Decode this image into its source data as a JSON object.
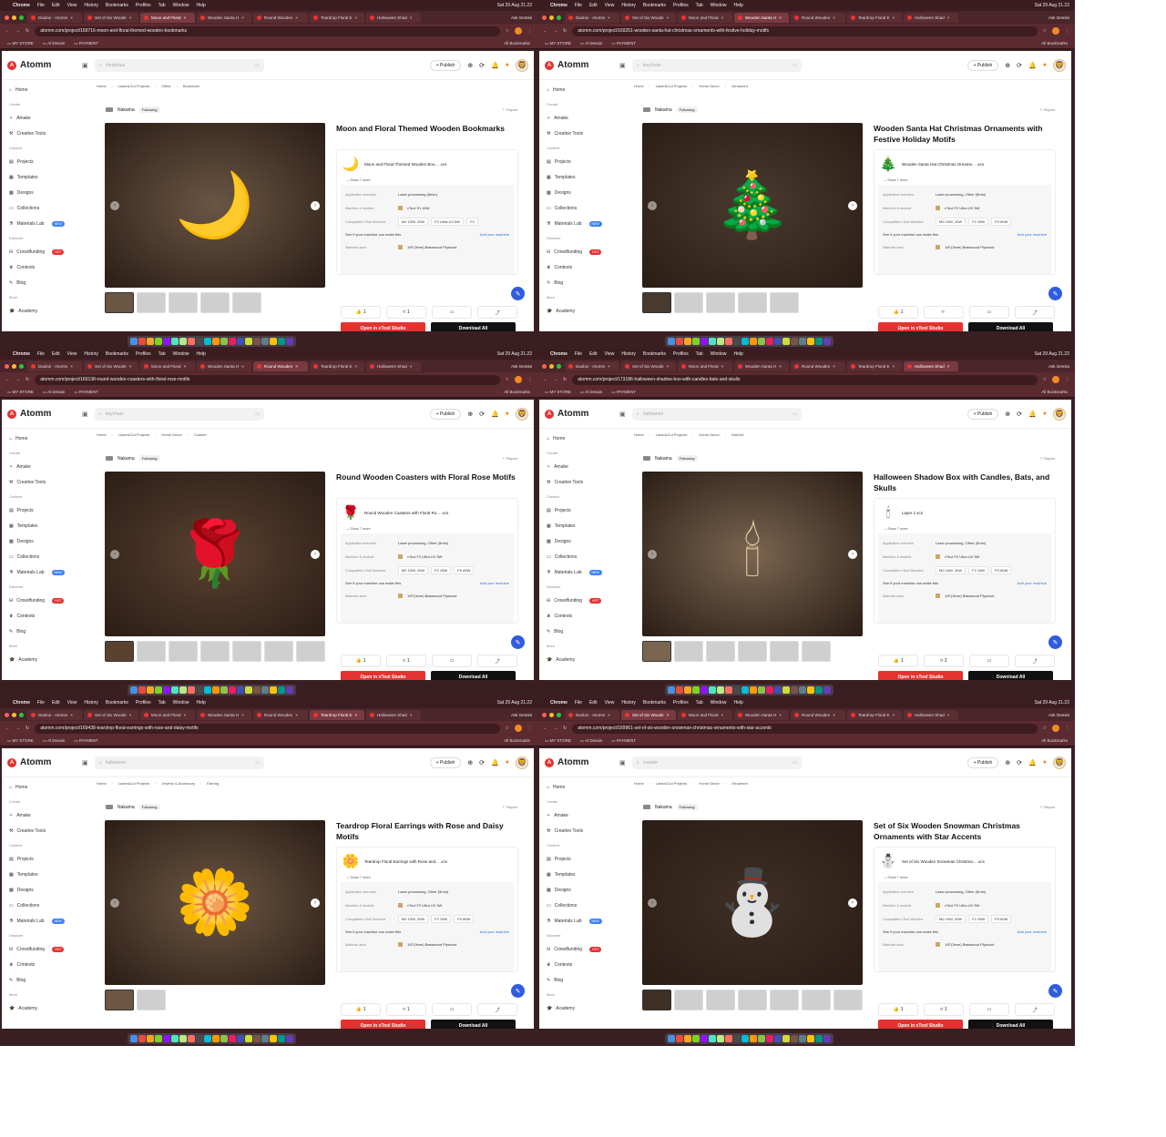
{
  "menubar": {
    "app": "Chrome",
    "items": [
      "File",
      "Edit",
      "View",
      "History",
      "Bookmarks",
      "Profiles",
      "Tab",
      "Window",
      "Help"
    ],
    "datetime": "Sat 29 Aug 21.22"
  },
  "tabs": [
    "Daoboi - Atomm",
    "Set of Six Woode",
    "Moon and Floral",
    "Wooden Santa H",
    "Round Wooden",
    "Teardrop Floral E",
    "Halloween Shad"
  ],
  "ask_label": "Ask Gemini",
  "bookmarks": [
    "MY STORE",
    "Al Desain",
    "PAYMENT"
  ],
  "all_bookmarks": "All Bookmarks",
  "site": {
    "logo": "Atomm",
    "publish": "+ Publish",
    "sidebar": {
      "home": "Home",
      "create_h": "Create",
      "amake": "Amake",
      "creative_tools": "Creative Tools",
      "content_h": "Content",
      "projects": "Projects",
      "templates": "Templates",
      "designs": "Designs",
      "collections": "Collections",
      "materials_lab": "Materials Lab",
      "new_badge": "NEW",
      "discover_h": "Discover",
      "crowdfunding": "Crowdfunding",
      "hot_badge": "HOT",
      "contests": "Contests",
      "blog": "Blog",
      "more_h": "More",
      "academy": "Academy"
    },
    "author": "Nakama",
    "following": "Following",
    "report": "Report",
    "show_more": "Show 7 more",
    "spec_labels": {
      "scenario": "Application scenario",
      "machine": "Machine & module",
      "compatible": "Compatible xTool Machine",
      "material": "Material used"
    },
    "fit_text": "See if your machine can make this",
    "add_machine": "Add your machine",
    "open_btn": "Open in xTool Studio",
    "download_btn": "Download All"
  },
  "screens": [
    {
      "url": "atomm.com/project/169716-moon-and-floral-themed-wooden-bookmarks",
      "active_tab": 2,
      "search": "christmas",
      "crumb": [
        "Home",
        "Laser&Cut Projects",
        "Office",
        "Bookmark"
      ],
      "title": "Moon and Floral Themed Wooden Bookmarks",
      "file": "Moon and Floral Themed Wooden Boo... .xcs",
      "file_icon": "bookmark-glyph",
      "scenario": "Laser processing (5min)",
      "machine": "xTool S1 40W",
      "compat": [
        "M2 10W, 20W",
        "F2 Ultra UV 5W",
        "F2"
      ],
      "material": "1/8\"(3mm) Basswood Plywood",
      "likes": "1",
      "saves": "1",
      "hero_color": "#6b5644",
      "hero_glyph": "🌙",
      "thumbs": 5
    },
    {
      "url": "atomm.com/project/169251-wooden-santa-hat-christmas-ornaments-with-festive-holiday-motifs",
      "active_tab": 3,
      "search": "keychain",
      "crumb": [
        "Home",
        "Laser&Cut Projects",
        "Home Decor",
        "Ornament"
      ],
      "title": "Wooden Santa Hat Christmas Ornaments with Festive Holiday Motifs",
      "file": "Wooden Santa Hat Christmas Orname... .xcs",
      "file_icon": "santa-hat-glyph",
      "scenario": "Laser processing, Other (5min)",
      "machine": "xTool F2 Ultra UV 5W",
      "compat": [
        "M2 10W, 20W",
        "F2 15W",
        "P3 80W"
      ],
      "material": "1/8\"(3mm) Basswood Plywood",
      "likes": "1",
      "saves": "",
      "hero_color": "#4a3a2e",
      "hero_glyph": "🎄",
      "thumbs": 5
    },
    {
      "url": "atomm.com/project/169138-round-wooden-coasters-with-floral-rose-motifs",
      "active_tab": 4,
      "search": "keychain",
      "crumb": [
        "Home",
        "Laser&Cut Projects",
        "Home Decor",
        "Coaster"
      ],
      "title": "Round Wooden Coasters with Floral Rose Motifs",
      "file": "Round Wooden Coasters with Floral Ro... .xcs",
      "file_icon": "rose-glyph",
      "scenario": "Laser processing, Other (5min)",
      "machine": "xTool F2 Ultra UV 5W",
      "compat": [
        "M2 10W, 20W",
        "F2 15W",
        "P3 80W"
      ],
      "material": "1/8\"(3mm) Basswood Plywood",
      "likes": "1",
      "saves": "1",
      "hero_color": "#5a4130",
      "hero_glyph": "🌹",
      "thumbs": 7
    },
    {
      "url": "atomm.com/project/173186-halloween-shadow-box-with-candles-bats-and-skulls",
      "active_tab": 6,
      "search": "halloween",
      "crumb": [
        "Home",
        "Laser&Cut Projects",
        "Home Decor",
        "Wall Art"
      ],
      "title": "Halloween Shadow Box with Candles, Bats, and Skulls",
      "file": "Layer 1.xcs",
      "file_icon": "candles-glyph",
      "scenario": "Laser processing, Other (5min)",
      "machine": "xTool F2 Ultra UV 5W",
      "compat": [
        "M2 10W, 20W",
        "F2 15W",
        "P3 80W"
      ],
      "material": "1/8\"(3mm) Basswood Plywood",
      "likes": "1",
      "saves": "2",
      "hero_color": "#7a6550",
      "hero_glyph": "🕯",
      "thumbs": 6
    },
    {
      "url": "atomm.com/project/169438-teardrop-floral-earrings-with-rose-and-daisy-motifs",
      "active_tab": 5,
      "search": "halloween",
      "crumb": [
        "Home",
        "Laser&Cut Projects",
        "Jewelry & Accessory",
        "Earring"
      ],
      "title": "Teardrop Floral Earrings with Rose and Daisy Motifs",
      "file": "Teardrop Floral Earrings with Rose and... .xcs",
      "file_icon": "earring-glyph",
      "scenario": "Laser processing, Other (5min)",
      "machine": "xTool F2 Ultra UV 5W",
      "compat": [
        "M2 10W, 20W",
        "F2 15W",
        "P3 80W"
      ],
      "material": "1/8\"(3mm) Basswood Plywood",
      "likes": "1",
      "saves": "1",
      "hero_color": "#6d5743",
      "hero_glyph": "🌼",
      "thumbs": 2
    },
    {
      "url": "atomm.com/project/169961-set-of-six-wooden-snowman-christmas-ornaments-with-star-accents",
      "active_tab": 1,
      "search": "coaster",
      "crumb": [
        "Home",
        "Laser&Cut Projects",
        "Home Decor",
        "Ornament"
      ],
      "title": "Set of Six Wooden Snowman Christmas Ornaments with Star Accents",
      "file": "Set of Six Wooden Snowman Christma... .xcs",
      "file_icon": "snowman-glyph",
      "scenario": "Laser processing, Other (5min)",
      "machine": "xTool F2 Ultra UV 5W",
      "compat": [
        "M2 10W, 20W",
        "F2 15W",
        "P3 80W"
      ],
      "material": "1/8\"(3mm) Basswood Plywood",
      "likes": "1",
      "saves": "1",
      "hero_color": "#3f2f25",
      "hero_glyph": "⛄",
      "thumbs": 7
    }
  ]
}
